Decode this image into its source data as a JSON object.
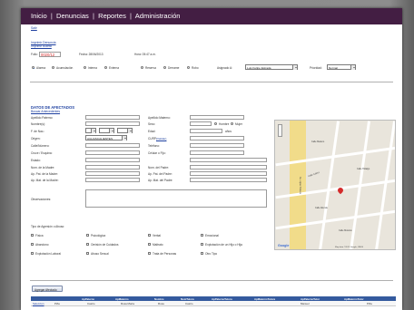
{
  "nav": {
    "items": [
      "Inicio",
      "Denuncias",
      "Reportes",
      "Administración"
    ],
    "separator": "|"
  },
  "links": {
    "salir": "Salir",
    "imprimir_denuncia": "Imprimir Denuncia",
    "imprimir_boleta": "Imprimir Boleta"
  },
  "header_fields": {
    "folio_label": "Folio:",
    "folio_value": "0020/12",
    "fecha_label": "Fecha: 28/06/2013",
    "hora_label": "Hora: 05:47 a.m."
  },
  "report_type": {
    "options": [
      "Alarma",
      "Acumulación",
      "Interna",
      "Externa",
      "Reserva",
      "Derrame",
      "Robo"
    ],
    "selected": "Alarma",
    "asignado_label": "Asignado A:",
    "asignado_value": "Luis Felipe Estrada",
    "prioridad_label": "Prioridad:",
    "prioridad_value": "Normal"
  },
  "affected": {
    "title": "DATOS DE AFECTADOS",
    "buscar": "Buscar Antecedentes",
    "fields_left": [
      "Apellido Paterno:",
      "Nombre(s):",
      "F. de Nac.:",
      "Origen:",
      "Calle/Número:",
      "Cruce / Esquina:",
      "Estado:",
      "Nom. de la Madre:",
      "Ap. Pat. de la Madre:",
      "Ap. Mat. de la Madre:"
    ],
    "fields_right": [
      "Apellido Materno:",
      "Sexo:",
      "Edad:",
      "CURP:",
      "Teléfono:",
      "Celular o Fijo:",
      "Nom. del Padre:",
      "Ap. Pat. del Padre:",
      "Ap. Mat. del Padre:"
    ],
    "sexo_options": [
      "Hombre",
      "Mujer"
    ],
    "edad_unit": "años",
    "origen_value": "AGUASCALIENTES",
    "curp_link": "(Validar)",
    "observaciones_label": "Observaciones:"
  },
  "agresion": {
    "title": "Tipo de Agresión o Abuso:",
    "options": [
      "Física",
      "Psicológica",
      "Verbal",
      "Emocional",
      "Abandono",
      "Omisión de Cuidados",
      "Maltrato",
      "Explotación de un Hijo o Hija",
      "Explotación Laboral",
      "Abuso Sexual",
      "Trata de Personas",
      "Otro Tipo"
    ]
  },
  "map": {
    "streets": [
      "Calle Madero",
      "Calle Hidalgo",
      "Calle Juárez",
      "Av. López Mateos",
      "Calle Allende",
      "Calle Morelos"
    ],
    "attribution": "Map data ©2013 Google, INEGI",
    "logo": "Google"
  },
  "table": {
    "add_button": "Agregar Afectado",
    "headers": [
      "ApPaterno",
      "ApMaterno",
      "Nombre",
      "NomTutora",
      "ApPaternoTutora",
      "ApMaternoTutora",
      "ApPaternoTutor",
      "ApMaternoTutor"
    ],
    "row_label": "Seleccion",
    "row": [
      "Piña",
      "Castro",
      "Rosa María",
      "Rosa",
      "Castro",
      "",
      "Manuel",
      "",
      "Piña"
    ]
  },
  "colors": {
    "topbar": "#431e43",
    "link": "#1e40a0",
    "folio": "#d42a2a",
    "table_header": "#345a9e"
  }
}
